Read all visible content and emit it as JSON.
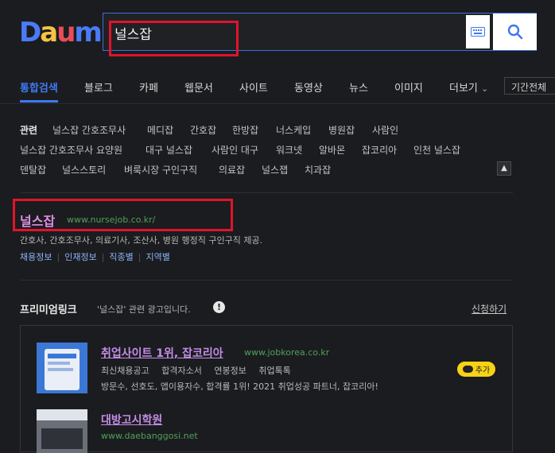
{
  "header": {
    "logo_text": "Daum",
    "search_value": "널스잡"
  },
  "tabs": [
    {
      "label": "통합검색",
      "active": true
    },
    {
      "label": "블로그"
    },
    {
      "label": "카페"
    },
    {
      "label": "웹문서"
    },
    {
      "label": "사이트"
    },
    {
      "label": "동영상"
    },
    {
      "label": "뉴스"
    },
    {
      "label": "이미지"
    },
    {
      "label": "더보기"
    }
  ],
  "period_label": "기간전체",
  "related": {
    "title": "관련",
    "rows": [
      [
        "널스잡 간호조무사",
        "메디잡",
        "간호잡",
        "한방잡",
        "너스케입",
        "병원잡",
        "사람인"
      ],
      [
        "널스잡 간호조무사 요양원",
        "대구 널스잡",
        "사람인 대구",
        "워크넷",
        "알바몬",
        "잡코리아",
        "인천 널스잡"
      ],
      [
        "덴탈잡",
        "널스스토리",
        "벼룩시장 구인구직",
        "의료잡",
        "널스잽",
        "치과잡"
      ]
    ]
  },
  "site_result": {
    "title": "널스잡",
    "url": "www.nursejob.co.kr/",
    "description": "간호사, 간호조무사, 의료기사, 조산사, 병원 행정직 구인구직 제공.",
    "links": [
      "채용정보",
      "인재정보",
      "직종별",
      "지역별"
    ]
  },
  "premium": {
    "title": "프리미엄링크",
    "subtitle": "'널스잡' 관련 광고입니다.",
    "apply_label": "신청하기",
    "ads": [
      {
        "title": "취업사이트 1위, 잡코리아",
        "url": "www.jobkorea.co.kr",
        "links": [
          "최신채용공고",
          "합격자소서",
          "연봉정보",
          "취업톡톡"
        ],
        "description": "방문수, 선호도, 앱이용자수, 합격률 1위! 2021 취업성공 파트너, 잡코리아!",
        "add_label": "추가"
      },
      {
        "title": "대방고시학원",
        "url": "www.daebanggosi.net"
      }
    ]
  },
  "colors": {
    "background": "#1b1c1f",
    "accent_blue": "#3f79f0",
    "highlight_red": "#e0142b",
    "title_pink": "#e08de6",
    "url_green": "#4fa15a"
  }
}
